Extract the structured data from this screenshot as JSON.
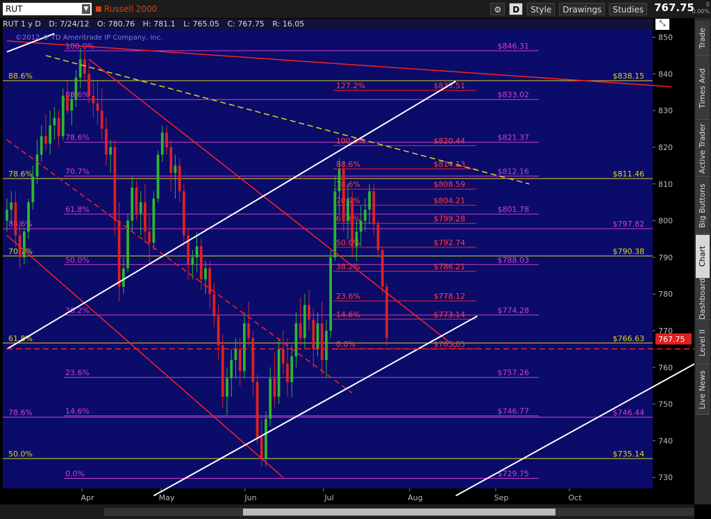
{
  "toolbar": {
    "symbol": "RUT",
    "title": "Russell 2000",
    "style_label": "Style",
    "drawings_label": "Drawings",
    "studies_label": "Studies",
    "d_label": "D",
    "last_price": "767.75",
    "change_top": "0",
    "change_bottom": "0.00%"
  },
  "infobar": {
    "symbol": "RUT 1 y D",
    "date": "D: 7/24/12",
    "open": "O: 780.76",
    "high": "H: 781.1",
    "low": "L: 765.05",
    "close": "C: 767.75",
    "range": "R: 16.05",
    "copyright": "©2012 © TD Ameritrade IP Company, Inc."
  },
  "side_tabs": [
    "Trade",
    "Times And Sales",
    "Active Trader",
    "Big Buttons",
    "Chart",
    "Dashboard",
    "Level II",
    "Live News"
  ],
  "colors": {
    "bg": "#0b0b6a",
    "up": "#2db82d",
    "down": "#e02020",
    "yellow": "#d8d820",
    "magenta": "#d040d0",
    "red": "#ff2020"
  },
  "chart_data": {
    "type": "candlestick",
    "ylim": [
      727,
      852
    ],
    "yticks": [
      730,
      740,
      750,
      760,
      770,
      780,
      790,
      800,
      810,
      820,
      830,
      840,
      850
    ],
    "xlabels": [
      "Apr",
      "May",
      "Jun",
      "Jul",
      "Aug",
      "Sep",
      "Oct"
    ],
    "last_price_tag": "767.75",
    "price_levels": [
      {
        "price": 838.15,
        "label": "$838.15",
        "color": "yellow"
      },
      {
        "price": 811.46,
        "label": "$811.46",
        "color": "yellow"
      },
      {
        "price": 790.38,
        "label": "$790.38",
        "color": "yellow"
      },
      {
        "price": 766.63,
        "label": "$766.63",
        "color": "yellow"
      },
      {
        "price": 735.14,
        "label": "$735.14",
        "color": "yellow"
      },
      {
        "price": 846.31,
        "label": "$846.31",
        "color": "magenta"
      },
      {
        "price": 833.02,
        "label": "$833.02",
        "color": "magenta"
      },
      {
        "price": 821.37,
        "label": "$821.37",
        "color": "magenta"
      },
      {
        "price": 812.16,
        "label": "$812.16",
        "color": "magenta"
      },
      {
        "price": 801.78,
        "label": "$801.78",
        "color": "magenta"
      },
      {
        "price": 797.82,
        "label": "$797.82",
        "color": "magenta"
      },
      {
        "price": 788.03,
        "label": "$788.03",
        "color": "magenta"
      },
      {
        "price": 774.28,
        "label": "$774.28",
        "color": "magenta"
      },
      {
        "price": 757.26,
        "label": "$757.26",
        "color": "magenta"
      },
      {
        "price": 746.77,
        "label": "$746.77",
        "color": "magenta"
      },
      {
        "price": 746.44,
        "label": "$746.44",
        "color": "magenta"
      },
      {
        "price": 729.75,
        "label": "$729.75",
        "color": "magenta"
      },
      {
        "price": 835.51,
        "label": "$835.51",
        "color": "red"
      },
      {
        "price": 820.44,
        "label": "$820.44",
        "color": "red"
      },
      {
        "price": 814.13,
        "label": "$814.13",
        "color": "red"
      },
      {
        "price": 808.59,
        "label": "$808.59",
        "color": "red"
      },
      {
        "price": 804.21,
        "label": "$804.21",
        "color": "red"
      },
      {
        "price": 799.28,
        "label": "$799.28",
        "color": "red"
      },
      {
        "price": 792.74,
        "label": "$792.74",
        "color": "red"
      },
      {
        "price": 786.21,
        "label": "$786.21",
        "color": "red"
      },
      {
        "price": 778.12,
        "label": "$778.12",
        "color": "red"
      },
      {
        "price": 773.14,
        "label": "$773.14",
        "color": "red"
      },
      {
        "price": 765.05,
        "label": "$765.05",
        "color": "red"
      }
    ],
    "fib_labels": [
      {
        "text": "88.6%",
        "price": 838.15,
        "color": "yellow",
        "group": "left"
      },
      {
        "text": "78.6%",
        "price": 811.46,
        "color": "yellow",
        "group": "left"
      },
      {
        "text": "70.7%",
        "price": 790.38,
        "color": "yellow",
        "group": "left"
      },
      {
        "text": "61.8%",
        "price": 766.63,
        "color": "yellow",
        "group": "left"
      },
      {
        "text": "50.0%",
        "price": 735.14,
        "color": "yellow",
        "group": "left"
      },
      {
        "text": "88.6%",
        "price": 797.82,
        "color": "magenta",
        "group": "left"
      },
      {
        "text": "78.6%",
        "price": 746.44,
        "color": "magenta",
        "group": "left"
      },
      {
        "text": "100.0%",
        "price": 846.31,
        "color": "magenta",
        "group": "mid"
      },
      {
        "text": "88.6%",
        "price": 833.02,
        "color": "magenta",
        "group": "mid"
      },
      {
        "text": "78.6%",
        "price": 821.37,
        "color": "magenta",
        "group": "mid"
      },
      {
        "text": "70.7%",
        "price": 812.16,
        "color": "magenta",
        "group": "mid"
      },
      {
        "text": "61.8%",
        "price": 801.78,
        "color": "magenta",
        "group": "mid"
      },
      {
        "text": "50.0%",
        "price": 788.03,
        "color": "magenta",
        "group": "mid"
      },
      {
        "text": "38.2%",
        "price": 774.28,
        "color": "magenta",
        "group": "mid"
      },
      {
        "text": "23.6%",
        "price": 757.26,
        "color": "magenta",
        "group": "mid"
      },
      {
        "text": "14.6%",
        "price": 746.77,
        "color": "magenta",
        "group": "mid"
      },
      {
        "text": "0.0%",
        "price": 729.75,
        "color": "magenta",
        "group": "mid"
      },
      {
        "text": "127.2%",
        "price": 835.51,
        "color": "red",
        "group": "right"
      },
      {
        "text": "100.0%",
        "price": 820.44,
        "color": "red",
        "group": "right"
      },
      {
        "text": "88.6%",
        "price": 814.13,
        "color": "red",
        "group": "right"
      },
      {
        "text": "78.6%",
        "price": 808.59,
        "color": "red",
        "group": "right"
      },
      {
        "text": "70.7%",
        "price": 804.21,
        "color": "red",
        "group": "right"
      },
      {
        "text": "61.8%",
        "price": 799.28,
        "color": "red",
        "group": "right"
      },
      {
        "text": "50.0%",
        "price": 792.74,
        "color": "red",
        "group": "right"
      },
      {
        "text": "38.2%",
        "price": 786.21,
        "color": "red",
        "group": "right"
      },
      {
        "text": "23.6%",
        "price": 778.12,
        "color": "red",
        "group": "right"
      },
      {
        "text": "14.6%",
        "price": 773.14,
        "color": "red",
        "group": "right"
      },
      {
        "text": "0.0%",
        "price": 765.05,
        "color": "red",
        "group": "right"
      }
    ],
    "candles": [
      [
        800,
        806,
        797,
        803
      ],
      [
        803,
        808,
        799,
        805
      ],
      [
        805,
        808,
        793,
        796
      ],
      [
        796,
        800,
        787,
        790
      ],
      [
        790,
        798,
        788,
        797
      ],
      [
        797,
        806,
        795,
        805
      ],
      [
        805,
        815,
        803,
        812
      ],
      [
        812,
        822,
        810,
        818
      ],
      [
        818,
        826,
        816,
        823
      ],
      [
        823,
        829,
        819,
        821
      ],
      [
        821,
        830,
        818,
        826
      ],
      [
        826,
        831,
        822,
        828
      ],
      [
        828,
        830,
        820,
        823
      ],
      [
        823,
        836,
        822,
        834
      ],
      [
        834,
        838,
        829,
        830
      ],
      [
        830,
        835,
        826,
        833
      ],
      [
        833,
        841,
        831,
        839
      ],
      [
        839,
        847,
        836,
        844
      ],
      [
        844,
        846,
        838,
        840
      ],
      [
        840,
        843,
        832,
        834
      ],
      [
        834,
        838,
        828,
        832
      ],
      [
        832,
        838,
        826,
        830
      ],
      [
        830,
        836,
        822,
        825
      ],
      [
        825,
        828,
        815,
        818
      ],
      [
        818,
        822,
        813,
        820
      ],
      [
        820,
        822,
        796,
        800
      ],
      [
        800,
        805,
        778,
        782
      ],
      [
        782,
        790,
        780,
        787
      ],
      [
        787,
        802,
        786,
        800
      ],
      [
        800,
        812,
        797,
        809
      ],
      [
        809,
        811,
        800,
        802
      ],
      [
        802,
        808,
        796,
        805
      ],
      [
        805,
        810,
        794,
        797
      ],
      [
        797,
        802,
        788,
        794
      ],
      [
        794,
        808,
        792,
        806
      ],
      [
        806,
        819,
        805,
        818
      ],
      [
        818,
        826,
        816,
        824
      ],
      [
        824,
        826,
        818,
        820
      ],
      [
        820,
        822,
        808,
        813
      ],
      [
        813,
        818,
        806,
        815
      ],
      [
        815,
        817,
        805,
        808
      ],
      [
        808,
        810,
        793,
        796
      ],
      [
        796,
        798,
        784,
        788
      ],
      [
        788,
        792,
        784,
        790
      ],
      [
        790,
        797,
        786,
        793
      ],
      [
        793,
        795,
        781,
        784
      ],
      [
        784,
        789,
        780,
        787
      ],
      [
        787,
        789,
        776,
        780
      ],
      [
        780,
        783,
        771,
        774
      ],
      [
        774,
        777,
        762,
        766
      ],
      [
        766,
        769,
        749,
        752
      ],
      [
        752,
        760,
        747,
        757
      ],
      [
        757,
        765,
        752,
        762
      ],
      [
        762,
        768,
        757,
        765
      ],
      [
        765,
        768,
        755,
        759
      ],
      [
        759,
        775,
        757,
        772
      ],
      [
        772,
        778,
        766,
        768
      ],
      [
        768,
        770,
        752,
        756
      ],
      [
        756,
        758,
        739,
        741
      ],
      [
        741,
        746,
        733,
        735
      ],
      [
        735,
        748,
        733,
        746
      ],
      [
        746,
        760,
        744,
        757
      ],
      [
        757,
        764,
        749,
        752
      ],
      [
        752,
        768,
        750,
        765
      ],
      [
        765,
        770,
        758,
        761
      ],
      [
        761,
        768,
        752,
        756
      ],
      [
        756,
        766,
        752,
        763
      ],
      [
        763,
        775,
        760,
        772
      ],
      [
        772,
        779,
        766,
        768
      ],
      [
        768,
        780,
        765,
        777
      ],
      [
        777,
        781,
        770,
        773
      ],
      [
        773,
        776,
        760,
        765
      ],
      [
        765,
        775,
        763,
        772
      ],
      [
        772,
        778,
        758,
        762
      ],
      [
        762,
        773,
        757,
        770
      ],
      [
        770,
        792,
        768,
        790
      ],
      [
        790,
        812,
        789,
        808
      ],
      [
        808,
        817,
        802,
        814
      ],
      [
        814,
        816,
        797,
        800
      ],
      [
        800,
        810,
        795,
        806
      ],
      [
        806,
        808,
        790,
        793
      ],
      [
        793,
        800,
        789,
        797
      ],
      [
        797,
        804,
        793,
        800
      ],
      [
        800,
        806,
        797,
        803
      ],
      [
        803,
        810,
        799,
        808
      ],
      [
        808,
        810,
        796,
        799
      ],
      [
        799,
        800,
        790,
        792
      ],
      [
        792,
        793,
        780,
        782
      ],
      [
        782,
        783,
        766,
        768
      ]
    ],
    "lines": [
      {
        "name": "downtrend-dashed-yellow",
        "color": "yellow",
        "dash": true,
        "points": [
          [
            9,
            845
          ],
          [
            121,
            810
          ]
        ]
      },
      {
        "name": "red-top-trendline",
        "color": "red",
        "dash": false,
        "points": [
          [
            0,
            849
          ],
          [
            154,
            836.5
          ]
        ]
      },
      {
        "name": "red-channel-upper",
        "color": "red",
        "dash": false,
        "points": [
          [
            19,
            844
          ],
          [
            104,
            765.5
          ]
        ]
      },
      {
        "name": "red-channel-mid-dashed",
        "color": "red",
        "dash": true,
        "points": [
          [
            0,
            822
          ],
          [
            80,
            753
          ]
        ]
      },
      {
        "name": "red-channel-lower",
        "color": "red",
        "dash": false,
        "points": [
          [
            0,
            796
          ],
          [
            64,
            730
          ]
        ]
      },
      {
        "name": "white-upper",
        "color": "white",
        "dash": false,
        "points": [
          [
            0,
            765
          ],
          [
            104,
            838
          ]
        ]
      },
      {
        "name": "white-lower",
        "color": "white",
        "dash": false,
        "points": [
          [
            34,
            725
          ],
          [
            109,
            774
          ]
        ]
      },
      {
        "name": "white-far",
        "color": "white",
        "dash": false,
        "points": [
          [
            104,
            725
          ],
          [
            164,
            764
          ]
        ]
      },
      {
        "name": "white-topleft",
        "color": "white",
        "dash": false,
        "points": [
          [
            0,
            846
          ],
          [
            11,
            851
          ]
        ]
      },
      {
        "name": "red-dashed-horizontal",
        "color": "red",
        "dash": true,
        "points": [
          [
            0,
            765.05
          ],
          [
            164,
            765.05
          ]
        ]
      }
    ]
  }
}
